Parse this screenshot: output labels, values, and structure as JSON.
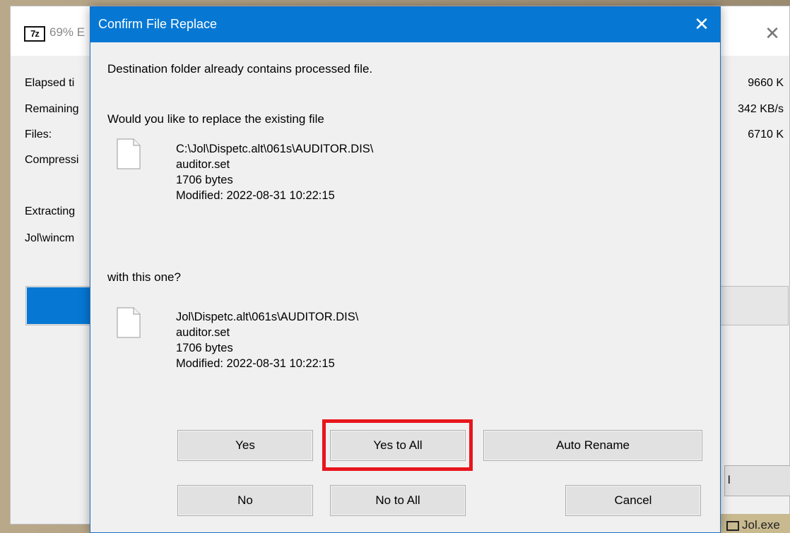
{
  "background_window": {
    "title": "69% E",
    "icon_label": "7z",
    "close_glyph": "✕",
    "labels": [
      "Elapsed ti",
      "Remaining",
      "Files:",
      "Compressi",
      "Extracting",
      "Jol\\wincm"
    ],
    "values": [
      "9660 K",
      "342 KB/s",
      "6710 K"
    ],
    "progress_fraction": 0.69,
    "button_label": "l",
    "taskbar_item": "Jol.exe"
  },
  "dialog": {
    "title": "Confirm File Replace",
    "close_glyph": "✕",
    "message_line1": "Destination folder already contains processed file.",
    "message_line2": "Would you like to replace the existing file",
    "existing_file": {
      "path": "C:\\Jol\\Dispetc.alt\\061s\\AUDITOR.DIS\\",
      "name": "auditor.set",
      "size": "1706 bytes",
      "modified": "Modified: 2022-08-31 10:22:15"
    },
    "with_prompt": "with this one?",
    "new_file": {
      "path": "Jol\\Dispetc.alt\\061s\\AUDITOR.DIS\\",
      "name": "auditor.set",
      "size": "1706 bytes",
      "modified": "Modified: 2022-08-31 10:22:15"
    },
    "buttons": {
      "yes": "Yes",
      "yes_to_all": "Yes to All",
      "auto_rename": "Auto Rename",
      "no": "No",
      "no_to_all": "No to All",
      "cancel": "Cancel"
    },
    "highlighted_button": "yes_to_all"
  },
  "colors": {
    "titlebar": "#0678d4",
    "highlight": "#e8151c",
    "dialog_bg": "#f0f0f0",
    "button_bg": "#e1e1e1"
  }
}
